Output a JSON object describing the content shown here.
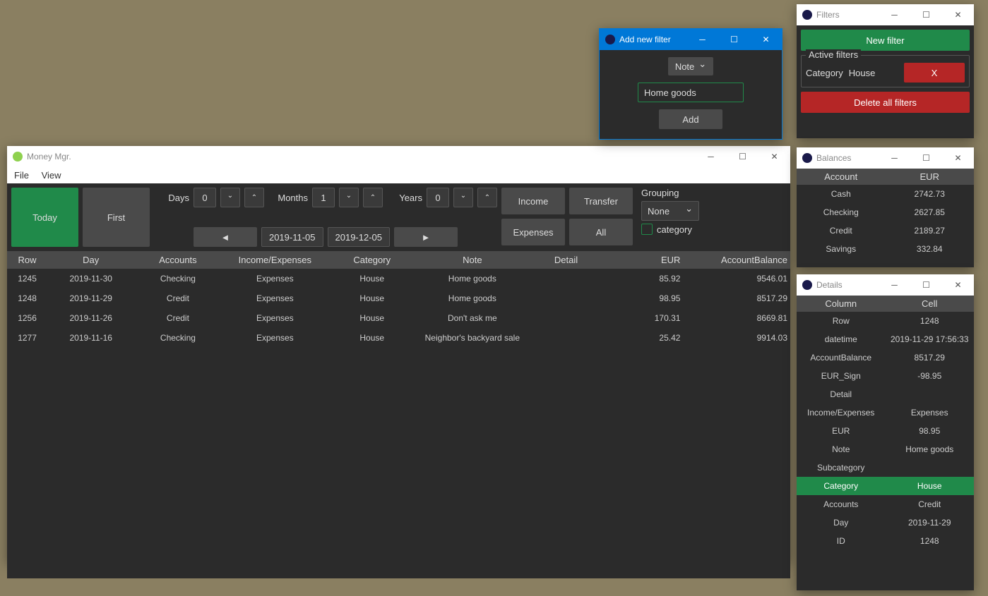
{
  "main": {
    "title": "Money Mgr.",
    "menu": {
      "file": "File",
      "view": "View"
    },
    "toolbar": {
      "today": "Today",
      "first": "First",
      "days_label": "Days",
      "days_val": "0",
      "months_label": "Months",
      "months_val": "1",
      "years_label": "Years",
      "years_val": "0",
      "date_from": "2019-11-05",
      "date_to": "2019-12-05",
      "income": "Income",
      "expenses": "Expenses",
      "transfer": "Transfer",
      "all": "All",
      "grouping_label": "Grouping",
      "grouping_value": "None",
      "category_check": "category"
    },
    "columns": {
      "row": "Row",
      "day": "Day",
      "accounts": "Accounts",
      "ie": "Income/Expenses",
      "category": "Category",
      "note": "Note",
      "detail": "Detail",
      "eur": "EUR",
      "balance": "AccountBalance"
    },
    "rows": [
      {
        "row": "1245",
        "day": "2019-11-30",
        "acc": "Checking",
        "ie": "Expenses",
        "cat": "House",
        "note": "Home goods",
        "det": "",
        "eur": "85.92",
        "bal": "9546.01"
      },
      {
        "row": "1248",
        "day": "2019-11-29",
        "acc": "Credit",
        "ie": "Expenses",
        "cat": "House",
        "note": "Home goods",
        "det": "",
        "eur": "98.95",
        "bal": "8517.29"
      },
      {
        "row": "1256",
        "day": "2019-11-26",
        "acc": "Credit",
        "ie": "Expenses",
        "cat": "House",
        "note": "Don't ask me",
        "det": "",
        "eur": "170.31",
        "bal": "8669.81"
      },
      {
        "row": "1277",
        "day": "2019-11-16",
        "acc": "Checking",
        "ie": "Expenses",
        "cat": "House",
        "note": "Neighbor's backyard sale",
        "det": "",
        "eur": "25.42",
        "bal": "9914.03"
      }
    ]
  },
  "add_filter": {
    "title": "Add new filter",
    "field_select": "Note",
    "value": "Home goods",
    "add_btn": "Add"
  },
  "filters": {
    "title": "Filters",
    "new_btn": "New filter",
    "active_label": "Active filters",
    "active": {
      "key": "Category",
      "val": "House",
      "x": "X"
    },
    "delete_all": "Delete all filters"
  },
  "balances": {
    "title": "Balances",
    "col1": "Account",
    "col2": "EUR",
    "rows": [
      {
        "acc": "Cash",
        "eur": "2742.73"
      },
      {
        "acc": "Checking",
        "eur": "2627.85"
      },
      {
        "acc": "Credit",
        "eur": "2189.27"
      },
      {
        "acc": "Savings",
        "eur": "332.84"
      }
    ]
  },
  "details": {
    "title": "Details",
    "col1": "Column",
    "col2": "Cell",
    "rows": [
      {
        "k": "Row",
        "v": "1248",
        "hl": false
      },
      {
        "k": "datetime",
        "v": "2019-11-29 17:56:33",
        "hl": false
      },
      {
        "k": "AccountBalance",
        "v": "8517.29",
        "hl": false
      },
      {
        "k": "EUR_Sign",
        "v": "-98.95",
        "hl": false
      },
      {
        "k": "Detail",
        "v": "",
        "hl": false
      },
      {
        "k": "Income/Expenses",
        "v": "Expenses",
        "hl": false
      },
      {
        "k": "EUR",
        "v": "98.95",
        "hl": false
      },
      {
        "k": "Note",
        "v": "Home goods",
        "hl": false
      },
      {
        "k": "Subcategory",
        "v": "",
        "hl": false
      },
      {
        "k": "Category",
        "v": "House",
        "hl": true
      },
      {
        "k": "Accounts",
        "v": "Credit",
        "hl": false
      },
      {
        "k": "Day",
        "v": "2019-11-29",
        "hl": false
      },
      {
        "k": "ID",
        "v": "1248",
        "hl": false
      }
    ]
  }
}
